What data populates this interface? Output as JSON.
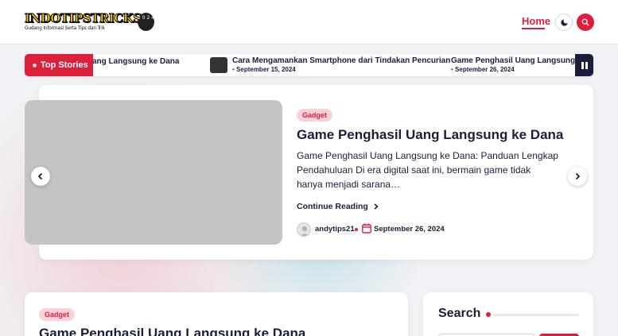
{
  "header": {
    "logo_main": "INDOTIPSTRICKS",
    "logo_sub": "Gudang Informasi Serta Tips dan Trik",
    "logo_badge": "2 0 2 4",
    "nav_home": "Home",
    "dark_mode_icon": "moon-icon",
    "search_icon": "search-icon",
    "accent_color": "#dc1f3b"
  },
  "ticker": {
    "label": "Top Stories",
    "items": [
      {
        "title": "ang Langsung ke Dana"
      },
      {
        "title": "Cara Mengamankan Smartphone dari Tindakan Pencurian",
        "date": "September 15, 2024"
      },
      {
        "title": "Game Penghasil Uang Langsung ke Dana",
        "date": "September 26, 2024"
      }
    ],
    "pause_icon": "pause-icon"
  },
  "slider": {
    "category": "Gadget",
    "title": "Game Penghasil Uang Langsung ke Dana",
    "excerpt": "Game Penghasil Uang Langsung ke Dana: Panduan Lengkap Pendahuluan Di era digital saat ini, bermain game tidak hanya menjadi sarana…",
    "read_more": "Continue Reading",
    "author": "andytips21",
    "date": "September 26, 2024"
  },
  "post": {
    "category": "Gadget",
    "title": "Game Penghasil Uang Langsung ke Dana"
  },
  "sidebar": {
    "search_heading": "Search"
  }
}
